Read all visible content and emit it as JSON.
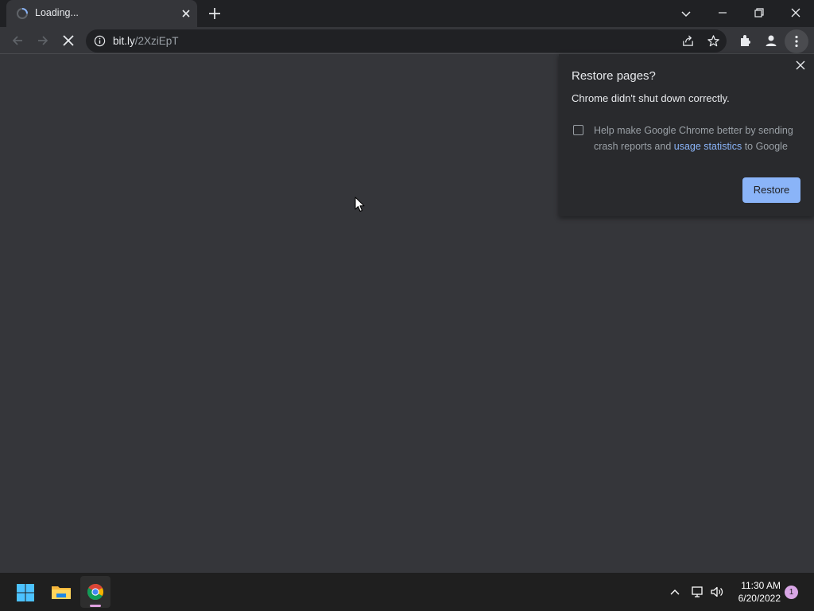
{
  "colors": {
    "frame": "#202124",
    "toolbar": "#35363a",
    "bubble": "#292a2d",
    "accent": "#8ab4f8",
    "taskbar": "#1f1f1f"
  },
  "tab": {
    "title": "Loading...",
    "icons": [
      "loading-spinner-icon",
      "close-icon"
    ]
  },
  "window_controls": [
    "tab-search-chevron-icon",
    "minimize-icon",
    "restore-icon",
    "close-icon"
  ],
  "toolbar": {
    "icons": [
      "back-arrow-icon",
      "forward-arrow-icon",
      "stop-loading-icon",
      "share-icon",
      "star-icon",
      "puzzle-extensions-icon",
      "profile-icon",
      "kebab-menu-icon"
    ]
  },
  "omnibox": {
    "host": "bit.ly",
    "path": "/2XziEpT"
  },
  "restore_bubble": {
    "title": "Restore pages?",
    "message": "Chrome didn't shut down correctly.",
    "checkbox_text_before": "Help make Google Chrome better by sending crash reports and ",
    "checkbox_link": "usage statistics",
    "checkbox_text_after": " to Google",
    "checkbox_checked": false,
    "restore_label": "Restore"
  },
  "taskbar": {
    "apps": [
      "windows-start-icon",
      "file-explorer-icon",
      "chrome-icon"
    ],
    "tray_icons": [
      "chevron-up-icon",
      "network-icon",
      "volume-icon"
    ],
    "time": "11:30 AM",
    "date": "6/20/2022",
    "notification_count": "1"
  }
}
